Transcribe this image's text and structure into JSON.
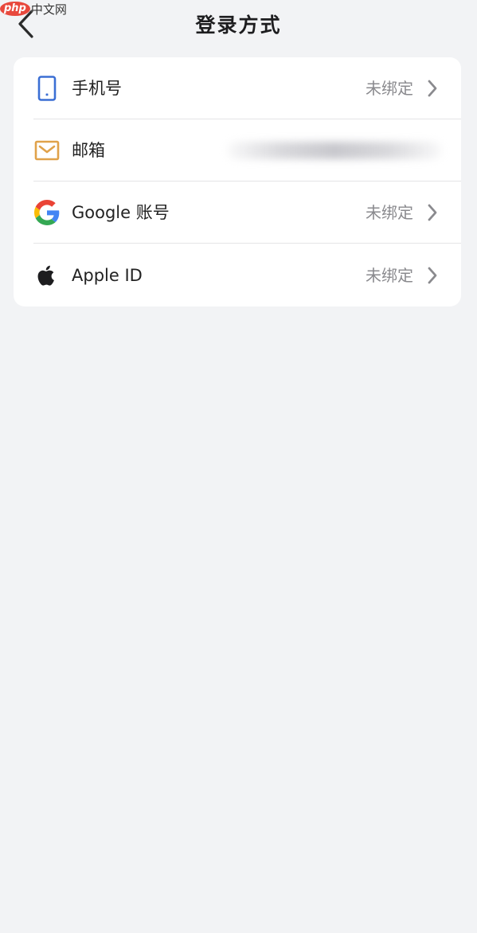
{
  "watermark": {
    "logo": "php",
    "text": "中文网"
  },
  "header": {
    "title": "登录方式"
  },
  "login_methods": [
    {
      "label": "手机号",
      "value": "未绑定",
      "icon": "phone-icon",
      "bound": false
    },
    {
      "label": "邮箱",
      "value": "",
      "icon": "mail-icon",
      "bound": true
    },
    {
      "label": "Google 账号",
      "value": "未绑定",
      "icon": "google-icon",
      "bound": false
    },
    {
      "label": "Apple ID",
      "value": "未绑定",
      "icon": "apple-icon",
      "bound": false
    }
  ],
  "colors": {
    "background": "#f2f3f5",
    "card": "#ffffff",
    "phone_icon": "#3b6fd4",
    "mail_icon": "#e0a24a",
    "secondary_text": "#8a8a8e"
  }
}
